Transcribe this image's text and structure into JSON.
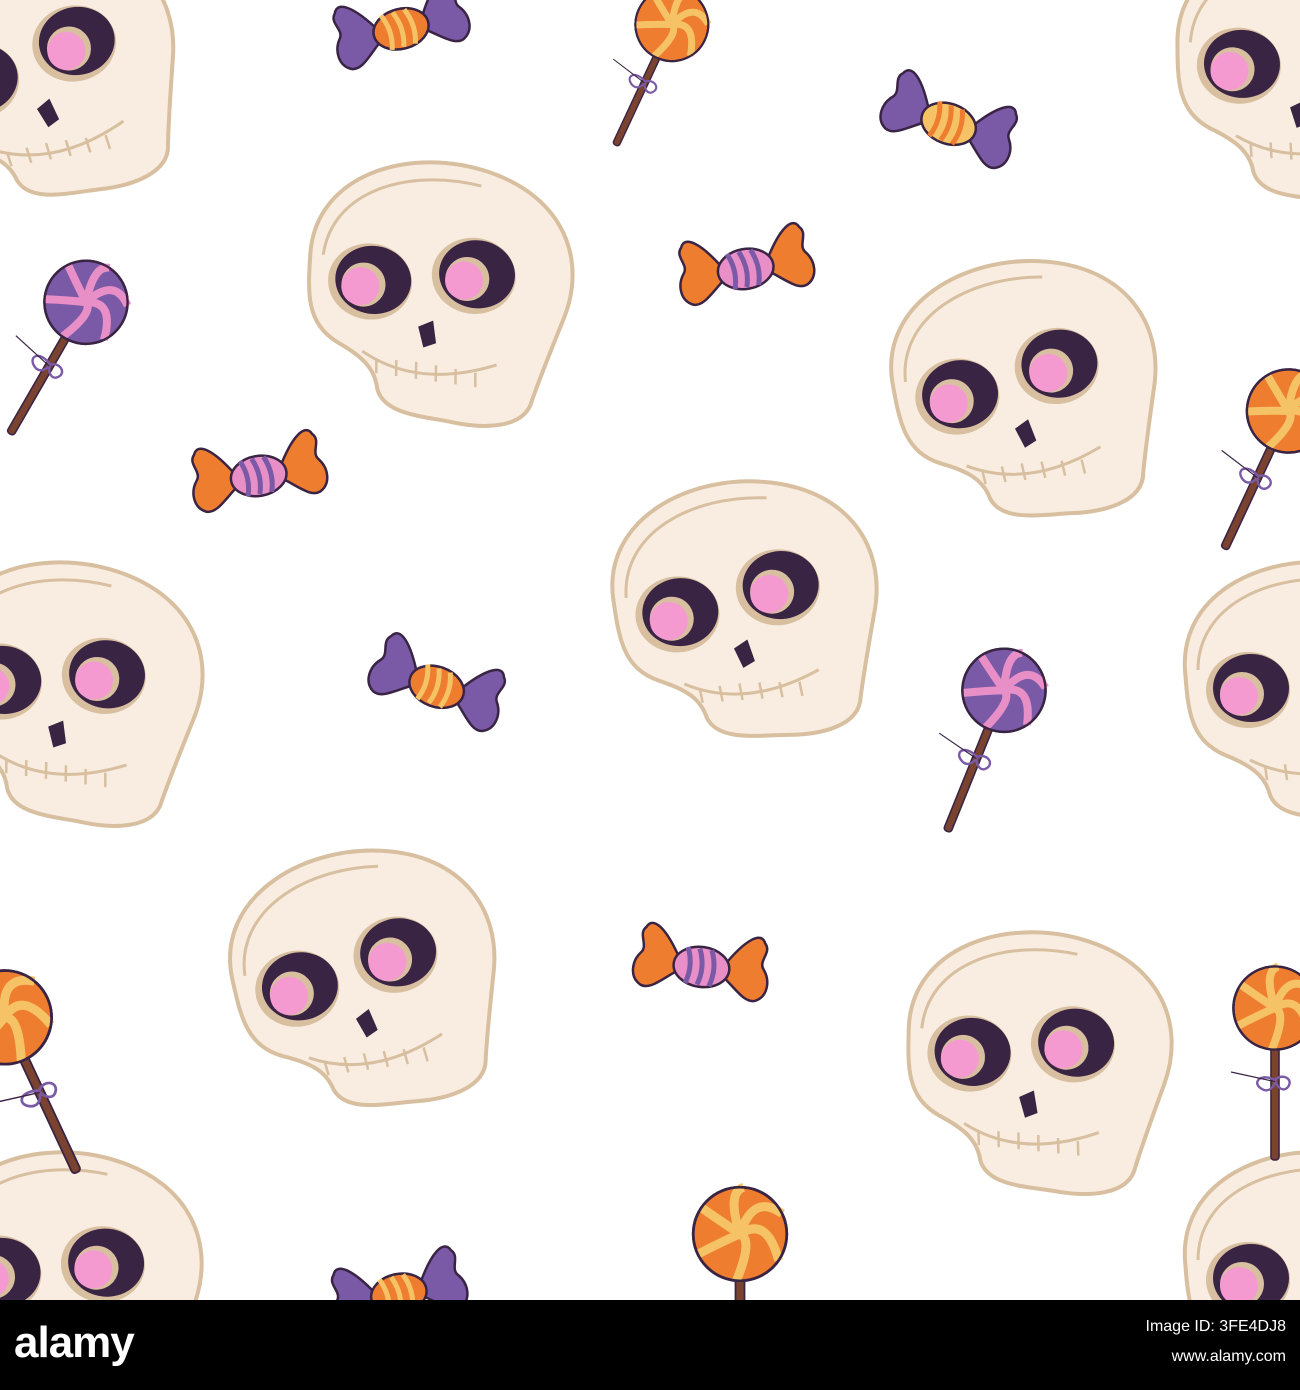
{
  "colors": {
    "background": "#ffffff",
    "skull_fill": "#f8ede0",
    "skull_outline": "#d7bfa0",
    "eye_dark": "#3a2444",
    "blush_pink": "#f59ad0",
    "nose": "#3a2444",
    "purple": "#7a5aa6",
    "orange": "#ee7d2f",
    "pink": "#e98fc7",
    "yellow": "#f6c266",
    "stick": "#7a4330",
    "bar": "#000000"
  },
  "watermark_bar": {
    "logo": "alamy",
    "image_id": "Image ID: 3FE4DJ8",
    "url": "www.alamy.com"
  },
  "icons": {
    "skull": "skull-icon",
    "wrapped_candy": "wrapped-candy-icon",
    "lollipop": "lollipop-icon"
  }
}
